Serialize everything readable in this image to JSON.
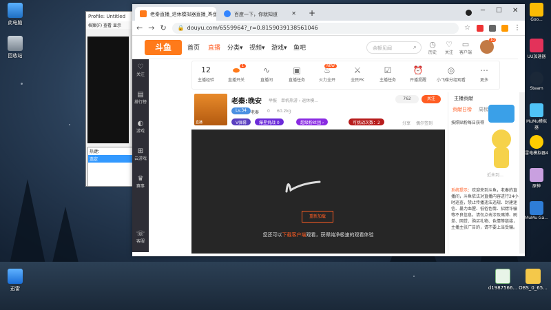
{
  "desktop": {
    "left_icons": [
      {
        "label": "此电脑",
        "icon": "computer-icon"
      },
      {
        "label": "回收站",
        "icon": "recycle-bin-icon"
      },
      {
        "label": "迅雷",
        "icon": "xunlei-icon"
      }
    ],
    "right_icons": [
      {
        "label": "Goo...",
        "icon": "google-icon"
      },
      {
        "label": "UU加速器",
        "icon": "uu-icon"
      },
      {
        "label": "Steam",
        "icon": "steam-icon"
      },
      {
        "label": "MuMu模拟器",
        "icon": "mumu-icon"
      },
      {
        "label": "雷电模拟器4",
        "icon": "ldplayer-icon"
      },
      {
        "label": "原神",
        "icon": "genshin-icon"
      },
      {
        "label": "MuMu Ga...",
        "icon": "mumu-game-icon"
      }
    ],
    "files": [
      {
        "label": "d1987566...",
        "icon": "image-file-icon"
      },
      {
        "label": "OBS_0_65...",
        "icon": "folder-icon"
      }
    ]
  },
  "background_window": {
    "title": "Profile: Untitled",
    "menu": "档案(F) 查看 显示",
    "list_items": [
      "热键：",
      "选定",
      "定"
    ],
    "footer": "0.0"
  },
  "browser": {
    "tabs": [
      {
        "title": "老秦直播_退休模拟器直播_斗鱼",
        "active": true
      },
      {
        "title": "百度一下，你就知道",
        "active": false
      }
    ],
    "new_tab": "+",
    "window_controls": {
      "minimize": "─",
      "maximize": "☐",
      "close": "✕"
    },
    "url": "douyu.com/6559964?_r=0.8159039138561046",
    "nav": {
      "back": "←",
      "forward": "→",
      "reload": "↻"
    }
  },
  "douyu": {
    "logo": "斗鱼",
    "nav": [
      "首页",
      "直播",
      "分类▾",
      "视频▾",
      "游戏▾",
      "鱼吧"
    ],
    "active_nav": "直播",
    "search_placeholder": "余额见闻",
    "header_icons": [
      {
        "label": "历史",
        "icon": "history-icon"
      },
      {
        "label": "关注",
        "icon": "heart-icon"
      },
      {
        "label": "客户端",
        "icon": "client-icon"
      }
    ],
    "avatar_badge": "10",
    "sidebar": [
      {
        "label": "关注",
        "icon": "heart-icon"
      },
      {
        "label": "排行榜",
        "icon": "rank-icon"
      },
      {
        "label": "游戏",
        "icon": "game-icon"
      },
      {
        "label": "云游戏",
        "icon": "cloud-game-icon"
      },
      {
        "label": "赛事",
        "icon": "trophy-icon"
      },
      {
        "label": "客服",
        "icon": "service-icon"
      }
    ],
    "toolbar": [
      {
        "label": "主播经验",
        "value": "12",
        "icon": ""
      },
      {
        "label": "直播开关",
        "icon": "toggle-icon",
        "badge": "1"
      },
      {
        "label": "直播间",
        "icon": "wave-icon"
      },
      {
        "label": "直播任务",
        "icon": "ad-icon"
      },
      {
        "label": "火力全开",
        "icon": "fire-icon",
        "badge": "NEW"
      },
      {
        "label": "全民PK",
        "icon": "pk-icon"
      },
      {
        "label": "主播任务",
        "icon": "task-icon"
      },
      {
        "label": "开播提醒",
        "icon": "clock-icon"
      },
      {
        "label": "小飞碟分组观看",
        "icon": "ufo-icon"
      },
      {
        "label": "更多",
        "icon": "more-icon"
      }
    ],
    "stream": {
      "title": "老秦:晚安",
      "meta1": "举报",
      "meta2": "单机热游 › 退休模...",
      "level": "Lv.34",
      "anchor": "老秦",
      "likes": "0",
      "weight": "60.2kg",
      "thumb_label": "直播",
      "pill_vip": "V弹幕",
      "pill_mission": "爆星挑战 0",
      "pill_event": "超级粉丝团 ›",
      "pill_count": "可挑战次数：2",
      "share": "分享",
      "report": "偶尔签到",
      "fans": "762",
      "follow": "关注"
    },
    "player": {
      "reload": "重新加载",
      "hint_prefix": "您还可以",
      "hint_link": "下载客户端",
      "hint_suffix": "观看，获得纯净极速的观看体验"
    },
    "right_panel": {
      "heading": "主播贡献",
      "tabs": [
        "贡献日榜",
        "周榜"
      ],
      "line1": "按照贴粉每日获得",
      "mascot_text": "近未到…",
      "system_label": "系统提示：",
      "system_text": "欢迎来到斗鱼，老秦的直播间，斗鱼依法对直播内容进行24小时巡查，禁止传播违法违规、封建迷信、暴力血腥、低俗色情、招嫖诈骗等不良信息。请勿点击涉及赌博、刷单、网贷、购买礼物、色情等链接，主播主张广告的，请不要上当受骗。"
    }
  }
}
